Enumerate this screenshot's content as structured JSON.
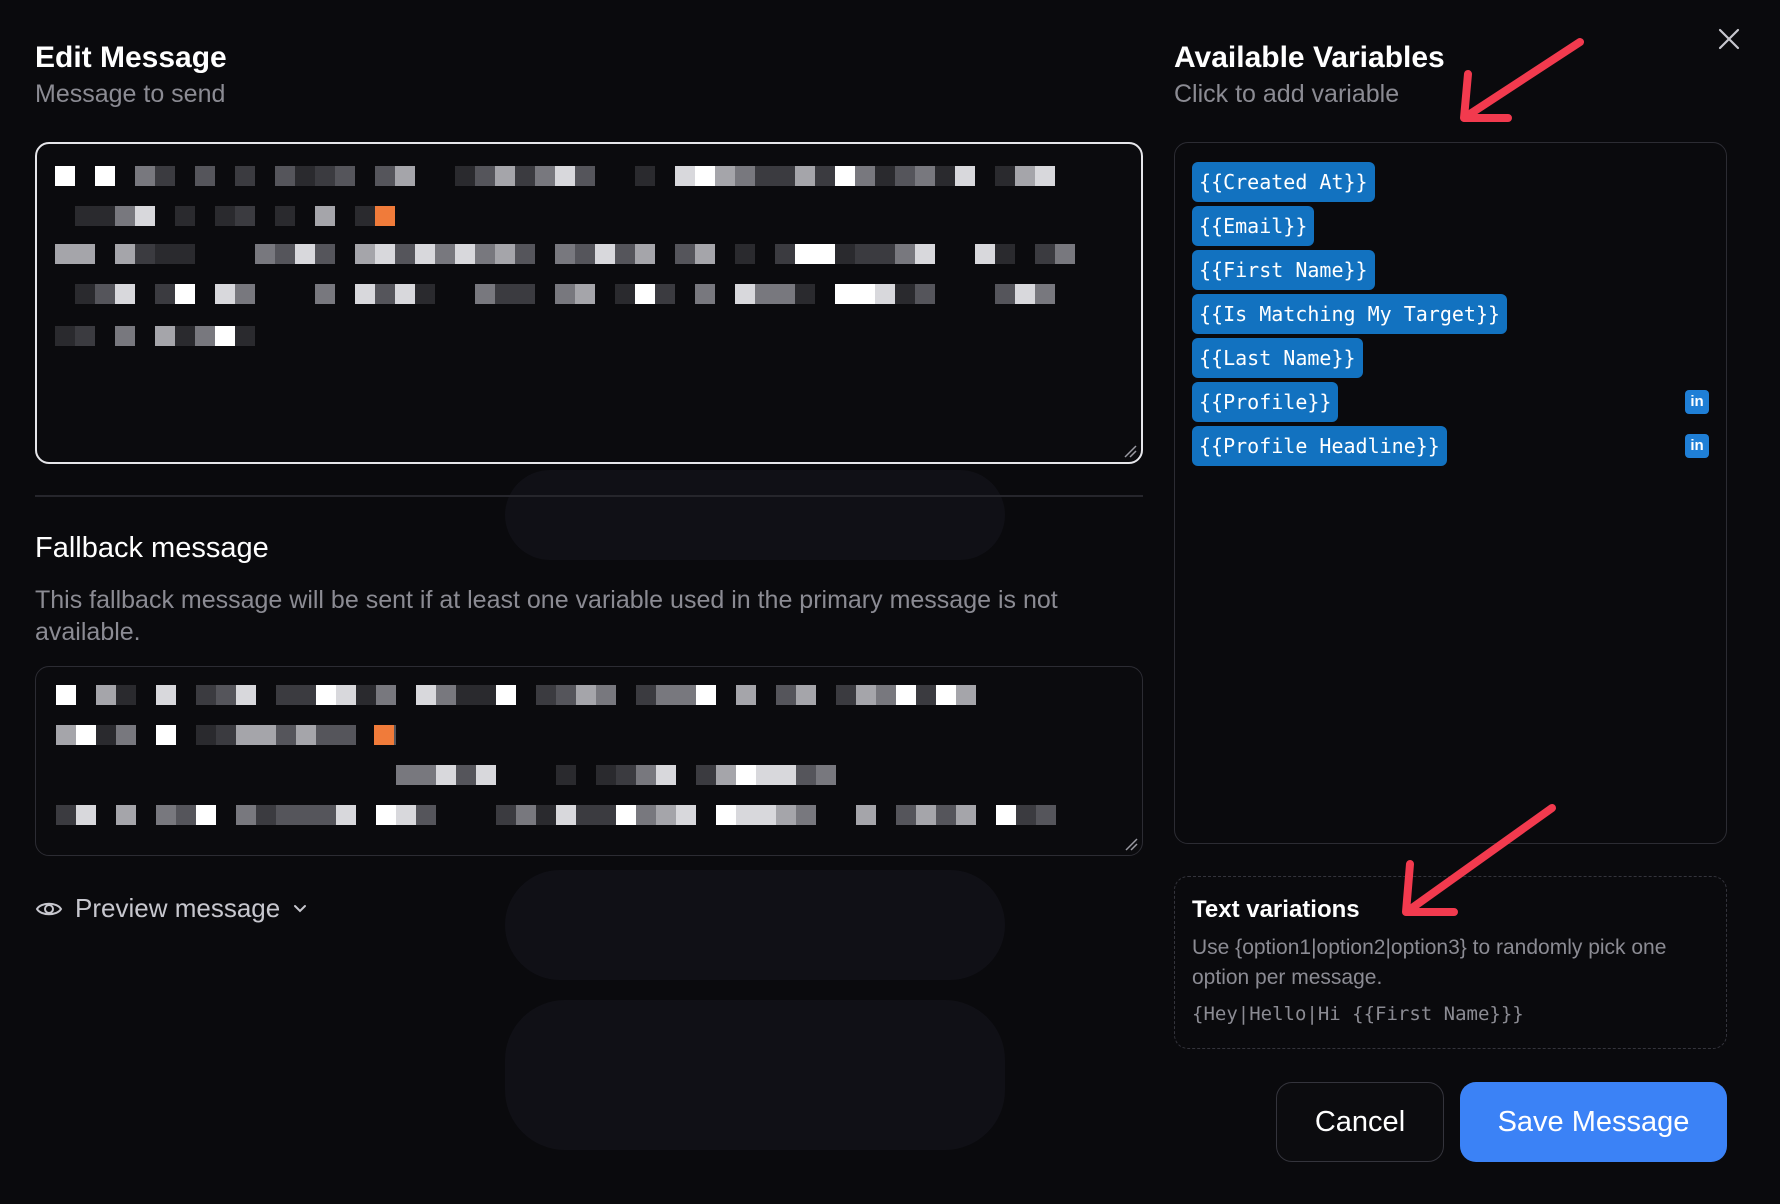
{
  "edit": {
    "title": "Edit Message",
    "subtitle": "Message to send"
  },
  "fallback": {
    "title": "Fallback message",
    "description": "This fallback message will be sent if at least one variable used in the primary message is not available."
  },
  "preview": {
    "label": "Preview message"
  },
  "variables": {
    "title": "Available Variables",
    "subtitle": "Click to add variable",
    "items": [
      {
        "label": "{{Created At}}",
        "linkedin": false
      },
      {
        "label": "{{Email}}",
        "linkedin": false
      },
      {
        "label": "{{First Name}}",
        "linkedin": false
      },
      {
        "label": "{{Is Matching My Target}}",
        "linkedin": false
      },
      {
        "label": "{{Last Name}}",
        "linkedin": false
      },
      {
        "label": "{{Profile}}",
        "linkedin": true,
        "badge": "in"
      },
      {
        "label": "{{Profile Headline}}",
        "linkedin": true,
        "badge": "in"
      }
    ]
  },
  "text_variations": {
    "title": "Text variations",
    "description": "Use {option1|option2|option3} to randomly pick one option per message.",
    "example": "{Hey|Hello|Hi {{First Name}}}"
  },
  "actions": {
    "cancel_label": "Cancel",
    "save_label": "Save Message"
  },
  "colors": {
    "accent": "#3b82f6",
    "variable_chip": "#1272c0",
    "annotation_arrow": "#f23a4e"
  },
  "icons": {
    "close": "close-icon",
    "preview": "eye-icon",
    "expand": "chevron-down-icon",
    "linkedin": "linkedin-icon"
  }
}
